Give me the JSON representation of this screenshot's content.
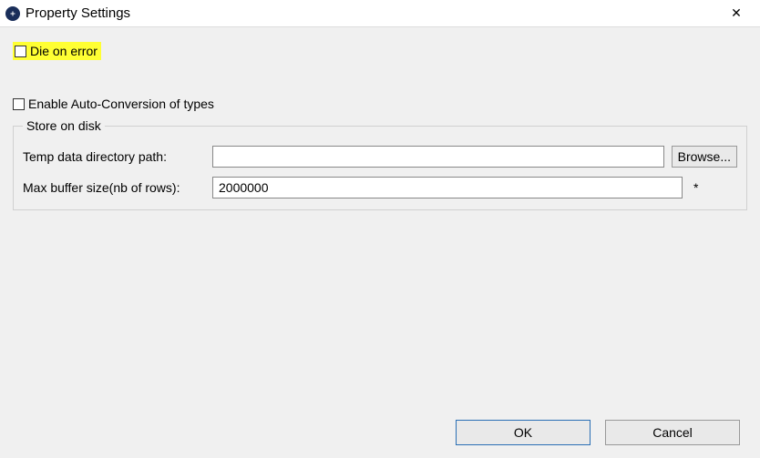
{
  "window": {
    "title": "Property Settings",
    "close_icon": "✕"
  },
  "fields": {
    "die_on_error": {
      "label": "Die on error",
      "checked": false,
      "highlighted": true
    },
    "enable_auto_conversion": {
      "label": "Enable Auto-Conversion of types",
      "checked": false
    }
  },
  "group": {
    "legend": "Store on disk",
    "temp_path": {
      "label": "Temp data directory path:",
      "value": "",
      "browse_label": "Browse..."
    },
    "max_buffer": {
      "label": "Max buffer size(nb of rows):",
      "value": "2000000",
      "required_mark": "*"
    }
  },
  "buttons": {
    "ok": "OK",
    "cancel": "Cancel"
  }
}
